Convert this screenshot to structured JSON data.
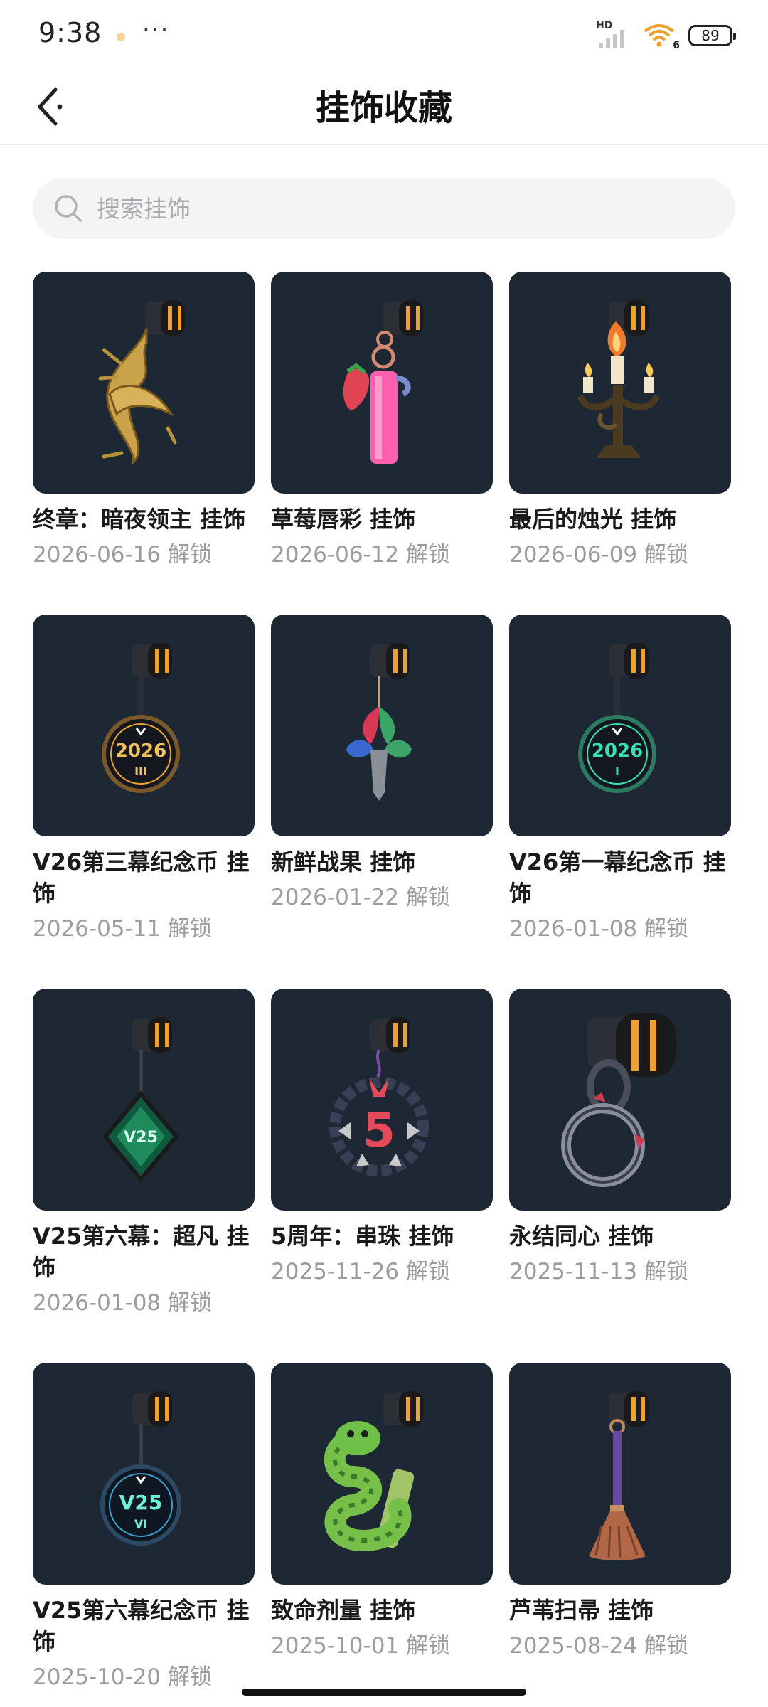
{
  "status_bar": {
    "time": "9:38",
    "more": "···",
    "network": "HD",
    "wifi_badge": "6",
    "battery": "89"
  },
  "header": {
    "title": "挂饰收藏"
  },
  "search": {
    "placeholder": "搜索挂饰"
  },
  "items": [
    {
      "name": "终章：暗夜领主 挂饰",
      "date": "2026-06-16 解锁",
      "icon": "golden-thorn-charm"
    },
    {
      "name": "草莓唇彩 挂饰",
      "date": "2026-06-12 解锁",
      "icon": "strawberry-lipstick-charm"
    },
    {
      "name": "最后的烛光 挂饰",
      "date": "2026-06-09 解锁",
      "icon": "candelabra-charm"
    },
    {
      "name": "V26第三幕纪念币 挂饰",
      "date": "2026-05-11 解锁",
      "icon": "coin-2026-iii-charm"
    },
    {
      "name": "新鲜战果 挂饰",
      "date": "2026-01-22 解锁",
      "icon": "leaf-tree-charm"
    },
    {
      "name": "V26第一幕纪念币 挂饰",
      "date": "2026-01-08 解锁",
      "icon": "coin-2026-i-charm"
    },
    {
      "name": "V25第六幕：超凡 挂饰",
      "date": "2026-01-08 解锁",
      "icon": "green-diamond-charm"
    },
    {
      "name": "5周年：串珠 挂饰",
      "date": "2025-11-26 解锁",
      "icon": "bead-ring-charm"
    },
    {
      "name": "永结同心 挂饰",
      "date": "2025-11-13 解锁",
      "icon": "linked-rings-charm"
    },
    {
      "name": "V25第六幕纪念币 挂饰",
      "date": "2025-10-20 解锁",
      "icon": "coin-v25-vi-charm"
    },
    {
      "name": "致命剂量 挂饰",
      "date": "2025-10-01 解锁",
      "icon": "snake-vial-charm"
    },
    {
      "name": "芦苇扫帚 挂饰",
      "date": "2025-08-24 解锁",
      "icon": "broom-charm"
    }
  ],
  "coin_texts": {
    "coin1_year": "2026",
    "coin1_act": "III",
    "coin2_year": "2026",
    "coin2_act": "I",
    "diamond": "V25",
    "bead_number": "5",
    "coin3_year": "V25",
    "coin3_act": "VI"
  },
  "colors": {
    "thumb_bg": "#1e2734",
    "clip_orange": "#f0a030",
    "gold": "#c9a24a",
    "teal": "#39e0b8",
    "pink": "#ff5fae"
  }
}
